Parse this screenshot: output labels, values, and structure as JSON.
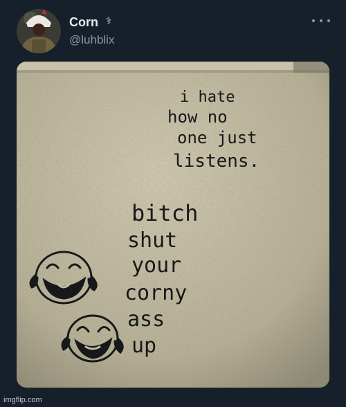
{
  "tweet": {
    "display_name": "Corn",
    "name_badge": "⚕",
    "handle": "@luhblix",
    "more_icon": "ellipsis-icon"
  },
  "image": {
    "wall_text_top": [
      "i hate",
      "how no",
      "one just",
      "listens."
    ],
    "wall_text_reply": [
      "bitch",
      "shut",
      "your",
      "corny",
      "ass",
      "up"
    ]
  },
  "footer": {
    "watermark": "imgflip.com"
  }
}
